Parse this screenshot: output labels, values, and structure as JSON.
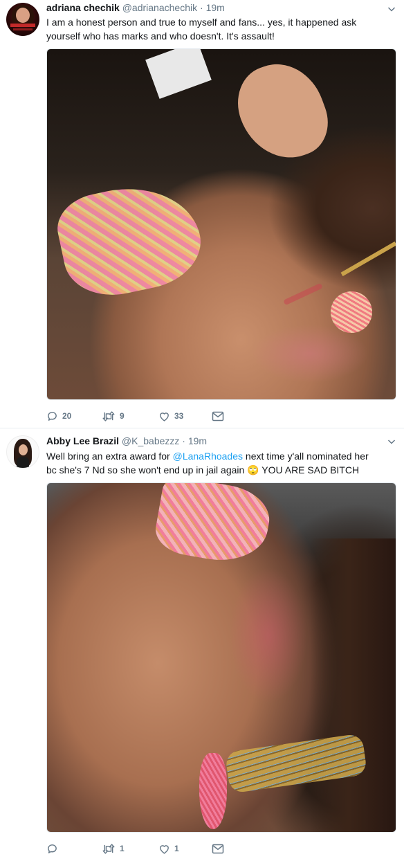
{
  "tweets": [
    {
      "name": "adriana chechik",
      "handle": "@adrianachechik",
      "separator": "·",
      "time": "19m",
      "text": "I am a honest person and true to myself and fans... yes, it happened ask yourself who has marks and who doesn't. It's assault!",
      "replies": "20",
      "retweets": "9",
      "likes": "33"
    },
    {
      "name": "Abby Lee Brazil",
      "handle": "@K_babezzz",
      "separator": "·",
      "time": "19m",
      "text_part1": "Well bring an extra award for ",
      "mention": "@LanaRhoades",
      "text_part2": " next time y'all nominated her bc she's 7 Nd so she won't end up in jail again ",
      "emoji": "🙄",
      "text_part3": " YOU ARE SAD BITCH",
      "replies": "",
      "retweets": "1",
      "likes": "1"
    }
  ],
  "colors": {
    "accent": "#1da1f2",
    "secondary_text": "#657786",
    "primary_text": "#14171a"
  }
}
